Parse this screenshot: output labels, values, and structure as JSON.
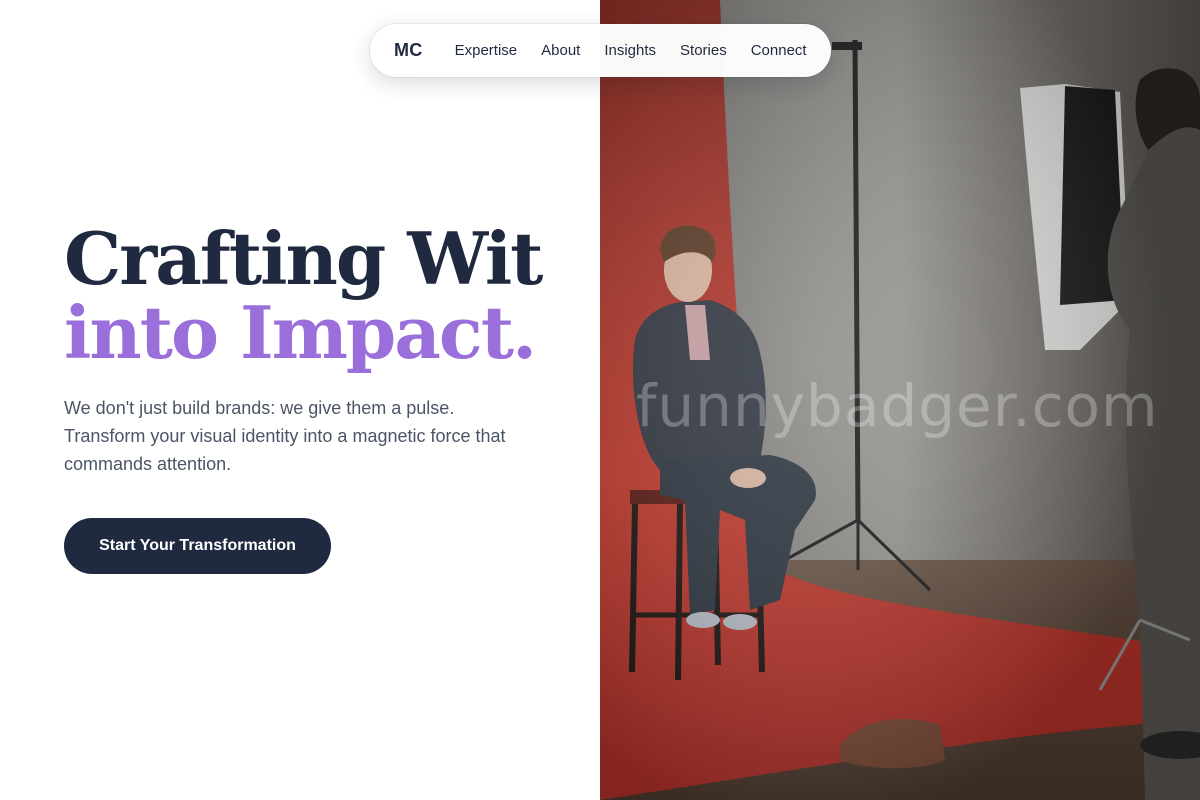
{
  "nav": {
    "logo": "MC",
    "links": [
      "Expertise",
      "About",
      "Insights",
      "Stories",
      "Connect"
    ]
  },
  "hero": {
    "headline_line1": "Crafting Wit",
    "headline_line2": "into Impact.",
    "subtext": "We don't just build brands: we give them a pulse. Transform your visual identity into a magnetic force that commands attention.",
    "cta_label": "Start Your Transformation"
  },
  "photo": {
    "description": "Man seated on a stool against a red backdrop in a photo studio, photographer with softbox on the right",
    "watermark": "funnybadger.com"
  },
  "colors": {
    "navy": "#1f2940",
    "accent_purple": "#9b6fdb",
    "body_text": "#4b5567",
    "backdrop_red": "#c8342a"
  }
}
